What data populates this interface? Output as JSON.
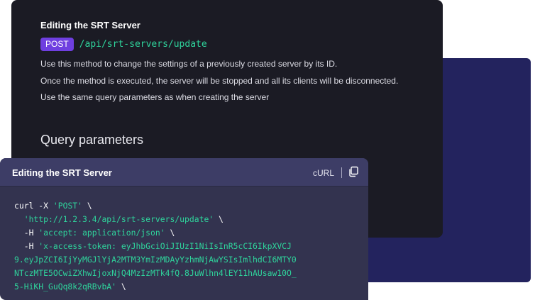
{
  "doc": {
    "title": "Editing the SRT Server",
    "method": "POST",
    "path": "/api/srt-servers/update",
    "descriptions": [
      "Use this method to change the settings of a previously created server by its ID.",
      "Once the method is executed, the server will be stopped and all its clients will be disconnected.",
      "Use the same query parameters as when creating the server"
    ],
    "section_heading": "Query parameters"
  },
  "code": {
    "title": "Editing the SRT Server",
    "language": "cURL",
    "copy_icon": "copy-icon",
    "lines": [
      [
        {
          "t": "curl ",
          "c": "cmd"
        },
        {
          "t": "-X ",
          "c": "flag"
        },
        {
          "t": "'POST'",
          "c": "str"
        },
        {
          "t": " \\",
          "c": "plain"
        }
      ],
      [
        {
          "t": "  ",
          "c": "plain"
        },
        {
          "t": "'http://1.2.3.4/api/srt-servers/update'",
          "c": "str"
        },
        {
          "t": " \\",
          "c": "plain"
        }
      ],
      [
        {
          "t": "  ",
          "c": "plain"
        },
        {
          "t": "-H ",
          "c": "flag"
        },
        {
          "t": "'accept: application/json'",
          "c": "str"
        },
        {
          "t": " \\",
          "c": "plain"
        }
      ],
      [
        {
          "t": "  ",
          "c": "plain"
        },
        {
          "t": "-H ",
          "c": "flag"
        },
        {
          "t": "'x-access-token: eyJhbGciOiJIUzI1NiIsInR5cCI6IkpXVCJ",
          "c": "str"
        }
      ],
      [
        {
          "t": "9.eyJpZCI6IjYyMGJlYjA2MTM3YmIzMDAyYzhmNjAwYSIsImlhdCI6MTY0",
          "c": "str"
        }
      ],
      [
        {
          "t": "NTczMTE5OCwiZXhwIjoxNjQ4MzIzMTk4fQ.8JuWlhn4lEY11hAUsaw10O_",
          "c": "str"
        }
      ],
      [
        {
          "t": "5-HiKH_GuQq8k2qRBvbA'",
          "c": "str"
        },
        {
          "t": " \\",
          "c": "plain"
        }
      ]
    ]
  },
  "colors": {
    "accent_green": "#2fd49c",
    "method_purple": "#6f3fe0",
    "doc_bg": "#1b1b24",
    "back_bg": "#23235e",
    "code_bg": "#33334f"
  }
}
